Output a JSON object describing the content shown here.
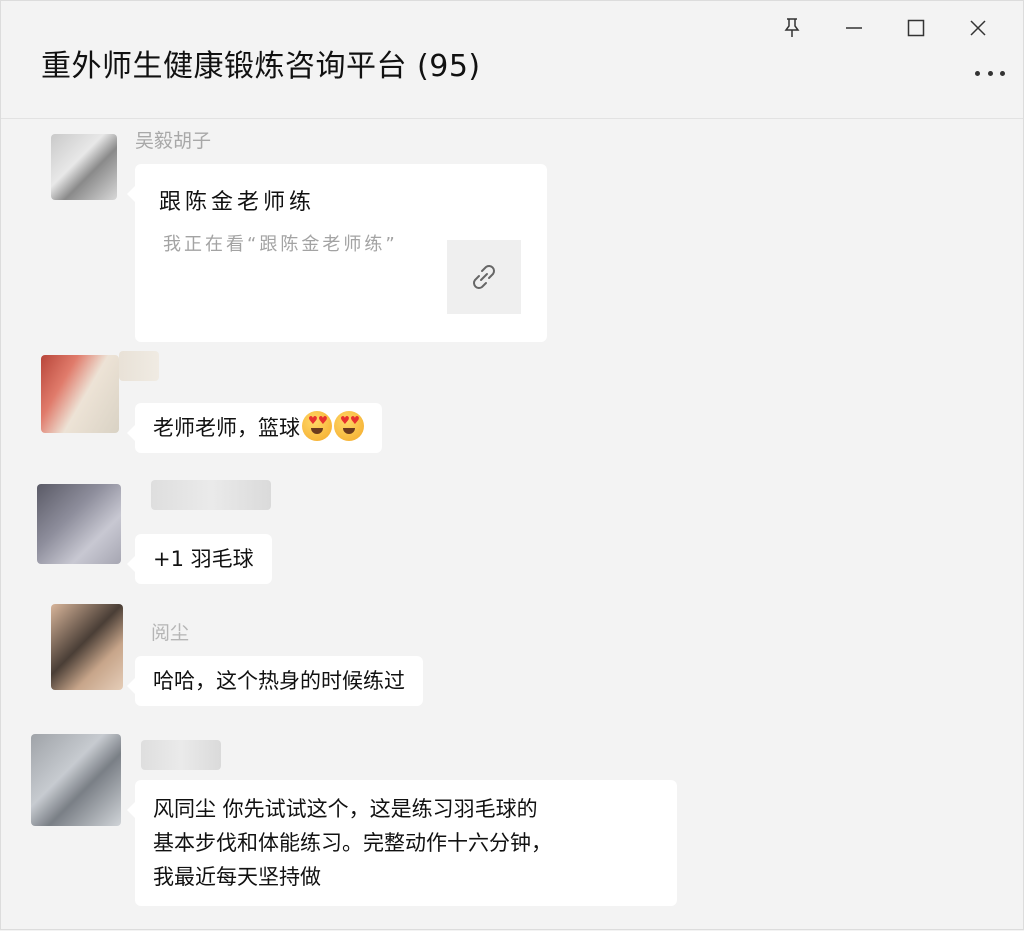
{
  "window": {
    "title": "重外师生健康锻炼咨询平台 (95)",
    "controls": [
      "pin-icon",
      "minimize-icon",
      "maximize-icon",
      "close-icon"
    ],
    "more_icon": "more-dots-icon"
  },
  "messages": [
    {
      "sender": "吴毅胡子",
      "type": "link_card",
      "card_title": "跟陈金老师练",
      "card_desc": "我正在看“跟陈金老师练”",
      "thumb_icon": "link-icon"
    },
    {
      "sender": "",
      "type": "text",
      "text": "老师老师，篮球",
      "emojis": [
        "heart-eyes-emoji",
        "heart-eyes-emoji"
      ]
    },
    {
      "sender": "",
      "type": "text",
      "text": "+1 羽毛球"
    },
    {
      "sender": "阅尘",
      "type": "text",
      "text": "哈哈，这个热身的时候练过"
    },
    {
      "sender": "",
      "type": "text",
      "text_line1": "风同尘 你先试试这个，这是练习羽毛球的",
      "text_line2": "基本步伐和体能练习。完整动作十六分钟，",
      "text_line3": "我最近每天坚持做"
    }
  ],
  "colors": {
    "background": "#f3f3f3",
    "bubble": "#ffffff",
    "sender_text": "#a8a8a8",
    "card_desc_text": "#a3a3a3"
  }
}
